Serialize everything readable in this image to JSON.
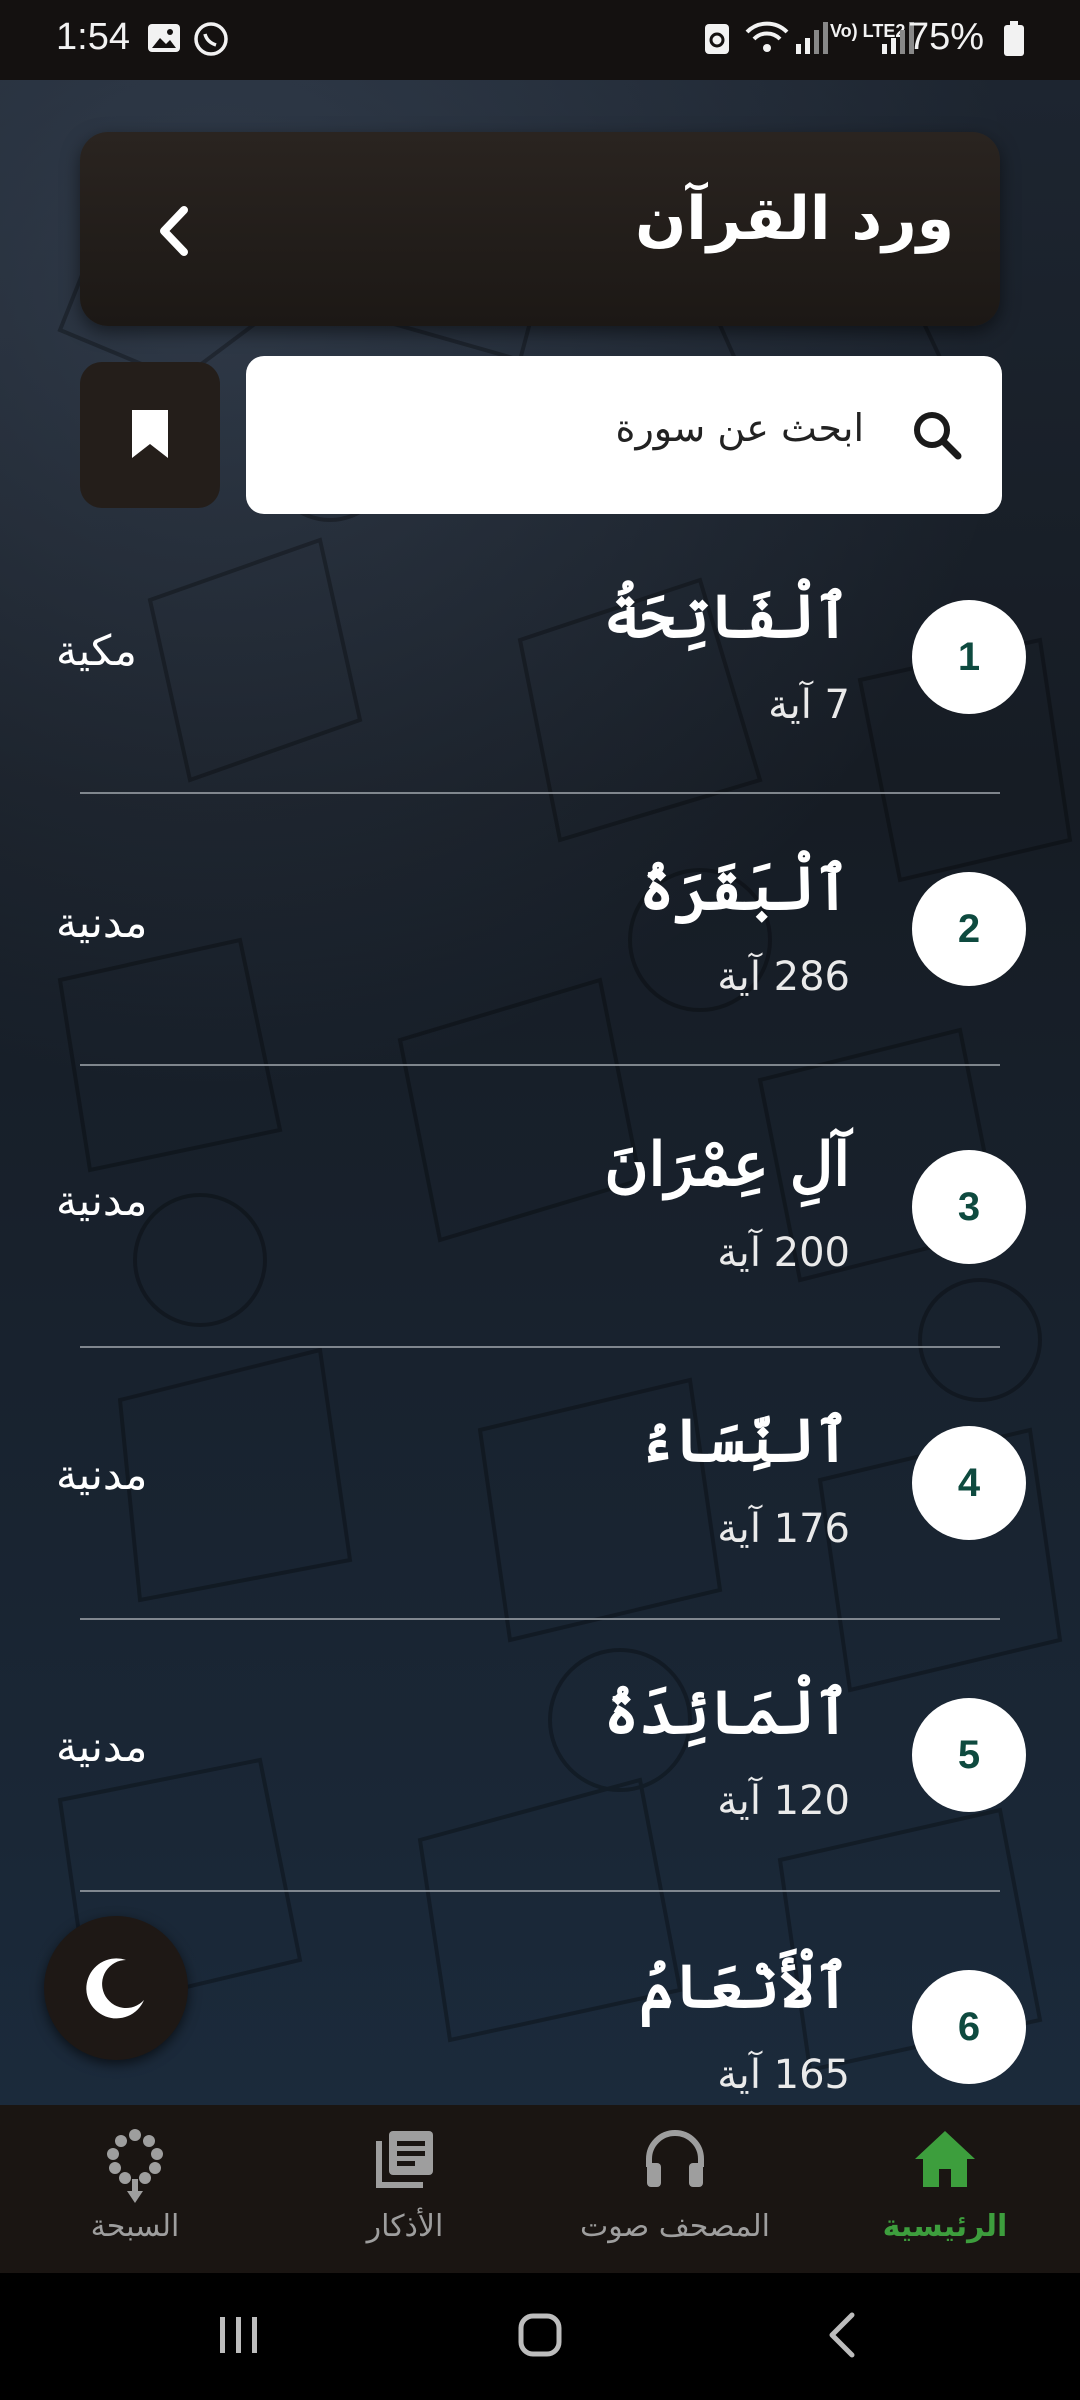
{
  "status_bar": {
    "time": "1:54",
    "battery": "75%",
    "network_label": "Vo) LTE2"
  },
  "header": {
    "title": "ورد القرآن"
  },
  "search": {
    "placeholder": "ابحث عن سورة"
  },
  "surahs": [
    {
      "number": "1",
      "name": "ٱلْفَاتِحَةُ",
      "ayahs": "7 آية",
      "type": "مكية"
    },
    {
      "number": "2",
      "name": "ٱلْبَقَرَةُ",
      "ayahs": "286 آية",
      "type": "مدنية"
    },
    {
      "number": "3",
      "name": "آلِ عِمْرَانَ",
      "ayahs": "200 آية",
      "type": "مدنية"
    },
    {
      "number": "4",
      "name": "ٱلنِّسَاءُ",
      "ayahs": "176 آية",
      "type": "مدنية"
    },
    {
      "number": "5",
      "name": "ٱلْمَائِدَةُ",
      "ayahs": "120 آية",
      "type": "مدنية"
    },
    {
      "number": "6",
      "name": "ٱلْأَنْعَامُ",
      "ayahs": "165 آية",
      "type": ""
    }
  ],
  "bottom_nav": [
    {
      "label": "السبحة",
      "icon": "prayer-beads-icon",
      "active": false
    },
    {
      "label": "الأذكار",
      "icon": "library-books-icon",
      "active": false
    },
    {
      "label": "المصحف صوت",
      "icon": "headphones-icon",
      "active": false
    },
    {
      "label": "الرئيسية",
      "icon": "home-icon",
      "active": true
    }
  ],
  "colors": {
    "accent_green": "#3d9e3d",
    "number_teal": "#0e4a3f",
    "panel_dark": "#241e1a"
  }
}
